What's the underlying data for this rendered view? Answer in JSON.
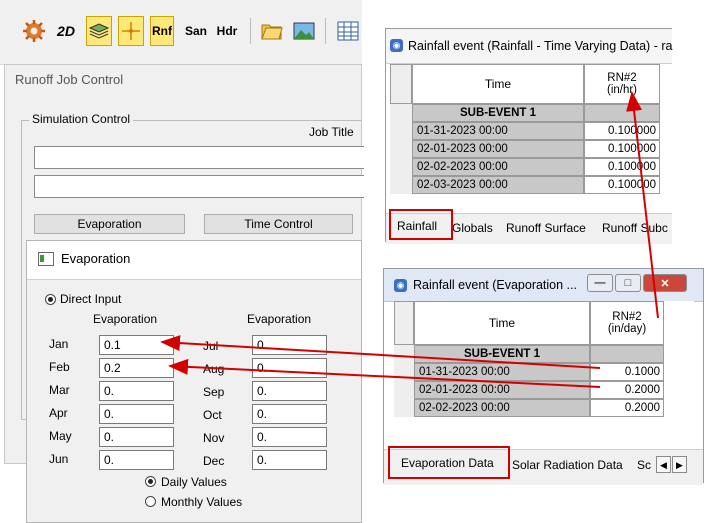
{
  "toolbar": {
    "items": [
      {
        "icon": "gear-run-icon"
      },
      {
        "icon": "2d-icon",
        "label": "2D"
      },
      {
        "icon": "layers-icon"
      },
      {
        "icon": "crosshair-icon"
      },
      {
        "label": "Rnf"
      },
      {
        "label": "San"
      },
      {
        "label": "Hdr"
      },
      {
        "icon": "folder-open-icon"
      },
      {
        "icon": "image-icon"
      },
      {
        "icon": "table-icon"
      }
    ]
  },
  "runoff_job_control": {
    "title": "Runoff Job Control",
    "group_title": "Simulation Control",
    "job_title_label": "Job Title",
    "buttons": {
      "evaporation": "Evaporation",
      "time_control": "Time Control"
    }
  },
  "evaporation": {
    "title": "Evaporation",
    "direct_input_label": "Direct Input",
    "col_header_left": "Evaporation",
    "col_header_right": "Evaporation",
    "months_left": [
      {
        "month": "Jan",
        "value": "0.1"
      },
      {
        "month": "Feb",
        "value": "0.2"
      },
      {
        "month": "Mar",
        "value": "0."
      },
      {
        "month": "Apr",
        "value": "0."
      },
      {
        "month": "May",
        "value": "0."
      },
      {
        "month": "Jun",
        "value": "0."
      }
    ],
    "months_right": [
      {
        "month": "Jul",
        "value": "0."
      },
      {
        "month": "Aug",
        "value": "0."
      },
      {
        "month": "Sep",
        "value": "0."
      },
      {
        "month": "Oct",
        "value": "0."
      },
      {
        "month": "Nov",
        "value": "0."
      },
      {
        "month": "Dec",
        "value": "0."
      }
    ],
    "daily_values_label": "Daily Values",
    "monthly_values_label": "Monthly Values",
    "selected": "Daily Values"
  },
  "rainfall_window": {
    "title": "Rainfall event (Rainfall - Time Varying Data) - ra",
    "col_time": "Time",
    "col_rn": "RN#2\n(in/hr)",
    "sub_event": "SUB-EVENT 1",
    "rows": [
      {
        "time": "01-31-2023 00:00",
        "value": "0.100000"
      },
      {
        "time": "02-01-2023 00:00",
        "value": "0.100000"
      },
      {
        "time": "02-02-2023 00:00",
        "value": "0.100000"
      },
      {
        "time": "02-03-2023 00:00",
        "value": "0.100000"
      }
    ],
    "tabs": [
      "Rainfall",
      "Globals",
      "Runoff Surface",
      "Runoff Subc"
    ],
    "active_tab": "Rainfall"
  },
  "evaporation_window": {
    "title": "Rainfall event (Evaporation ...",
    "col_time": "Time",
    "col_rn": "RN#2\n(in/day)",
    "sub_event": "SUB-EVENT 1",
    "rows": [
      {
        "time": "01-31-2023 00:00",
        "value": "0.1000"
      },
      {
        "time": "02-01-2023 00:00",
        "value": "0.2000"
      },
      {
        "time": "02-02-2023 00:00",
        "value": "0.2000"
      }
    ],
    "tabs": [
      "Evaporation Data",
      "Solar Radiation Data",
      "Sc"
    ],
    "active_tab": "Evaporation Data"
  },
  "colors": {
    "annotation": "#d40000",
    "title_icon": "#3b6fc4",
    "close_button": "#c9473b"
  }
}
